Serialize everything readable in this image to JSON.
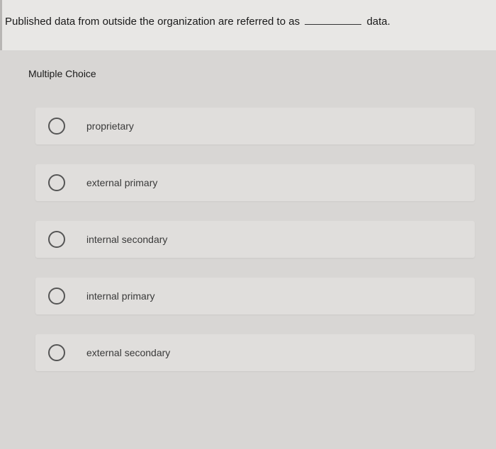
{
  "question": {
    "prefix": "Published data from outside the organization are referred to as",
    "suffix": "data."
  },
  "section_label": "Multiple Choice",
  "options": [
    {
      "label": "proprietary"
    },
    {
      "label": "external primary"
    },
    {
      "label": "internal secondary"
    },
    {
      "label": "internal primary"
    },
    {
      "label": "external secondary"
    }
  ]
}
